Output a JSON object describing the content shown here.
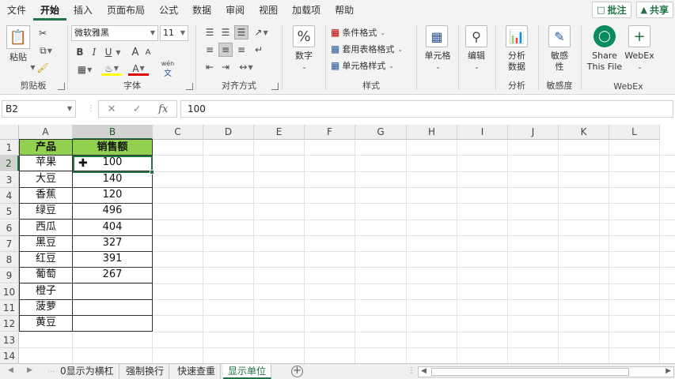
{
  "menu": {
    "items": [
      "文件",
      "开始",
      "插入",
      "页面布局",
      "公式",
      "数据",
      "审阅",
      "视图",
      "加载项",
      "帮助"
    ],
    "active_index": 1,
    "comments_label": "批注",
    "share_label": "共享"
  },
  "ribbon": {
    "clipboard": {
      "paste_label": "粘贴",
      "group_label": "剪贴板"
    },
    "font": {
      "font_name": "微软雅黑",
      "font_size": "11",
      "bold": "B",
      "italic": "I",
      "underline": "U",
      "grow": "A",
      "shrink": "A",
      "font_color": "A",
      "phonetic": "wén",
      "phonetic_sub": "文",
      "group_label": "字体"
    },
    "alignment": {
      "group_label": "对齐方式"
    },
    "number": {
      "label": "数字"
    },
    "styles": {
      "conditional": "条件格式",
      "table_style": "套用表格格式",
      "cell_style": "单元格样式",
      "group_label": "样式"
    },
    "cells": {
      "label": "单元格"
    },
    "editing": {
      "label": "编辑"
    },
    "analysis": {
      "label_1": "分析",
      "label_2": "数据",
      "group_label": "分析"
    },
    "sensitivity": {
      "label_1": "敏感",
      "label_2": "性",
      "group_label": "敏感度"
    },
    "webex": {
      "share_label_1": "Share",
      "share_label_2": "This File",
      "webex_label": "WebEx",
      "group_label": "WebEx"
    }
  },
  "formula_bar": {
    "name_box": "B2",
    "fx": "fx",
    "value": "100"
  },
  "columns": [
    "A",
    "B",
    "C",
    "D",
    "E",
    "F",
    "G",
    "H",
    "I",
    "J",
    "K",
    "L"
  ],
  "rows": [
    "1",
    "2",
    "3",
    "4",
    "5",
    "6",
    "7",
    "8",
    "9",
    "10",
    "11",
    "12",
    "13",
    "14"
  ],
  "table": {
    "header_product": "产品",
    "header_sales": "销售额",
    "products": [
      "苹果",
      "大豆",
      "香蕉",
      "绿豆",
      "西瓜",
      "黑豆",
      "红豆",
      "葡萄",
      "橙子",
      "菠萝",
      "黄豆"
    ],
    "sales": [
      "100",
      "140",
      "120",
      "496",
      "404",
      "327",
      "391",
      "267",
      "",
      "",
      ""
    ]
  },
  "colors": {
    "accent": "#217346",
    "header_fill": "#92d050"
  },
  "sheet_tabs": {
    "tabs": [
      "0显示为横杠",
      "强制换行",
      "快速查重",
      "显示单位"
    ],
    "active_index": 3,
    "add_label": "+"
  }
}
